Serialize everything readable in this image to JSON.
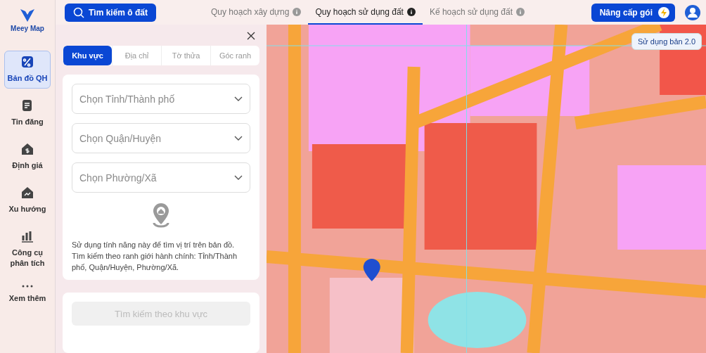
{
  "logo": {
    "text": "Meey Map"
  },
  "sidebar": {
    "items": [
      {
        "label": "Bản đồ QH",
        "selected": true
      },
      {
        "label": "Tin đăng",
        "selected": false
      },
      {
        "label": "Định giá",
        "selected": false
      },
      {
        "label": "Xu hướng",
        "selected": false
      },
      {
        "label": "Công cụ phân tích",
        "selected": false
      },
      {
        "label": "Xem thêm",
        "selected": false
      }
    ]
  },
  "search_button": {
    "label": "Tìm kiếm ô đất"
  },
  "tabs": [
    {
      "label": "Quy hoạch xây dựng",
      "selected": false
    },
    {
      "label": "Quy hoạch sử dụng đất",
      "selected": true
    },
    {
      "label": "Kế hoạch sử dụng đất",
      "selected": false
    }
  ],
  "upgrade_button": {
    "label": "Nâng cấp gói"
  },
  "panel": {
    "tabs": [
      {
        "label": "Khu vực",
        "selected": true
      },
      {
        "label": "Địa chỉ",
        "selected": false
      },
      {
        "label": "Tờ thửa",
        "selected": false
      },
      {
        "label": "Góc ranh",
        "selected": false
      }
    ],
    "selects": [
      {
        "placeholder": "Chọn Tỉnh/Thành phố"
      },
      {
        "placeholder": "Chọn Quận/Huyện"
      },
      {
        "placeholder": "Chọn Phường/Xã"
      }
    ],
    "hint": [
      "Sử dụng tính năng này để tìm vị trí trên bản đồ.",
      "Tìm kiếm theo ranh giới hành chính: Tỉnh/Thành phố, Quận/Huyện, Phường/Xã."
    ],
    "submit": {
      "label": "Tìm kiếm theo khu vực",
      "disabled": true
    }
  },
  "map": {
    "version_button": "Sử dụng bản 2.0"
  }
}
